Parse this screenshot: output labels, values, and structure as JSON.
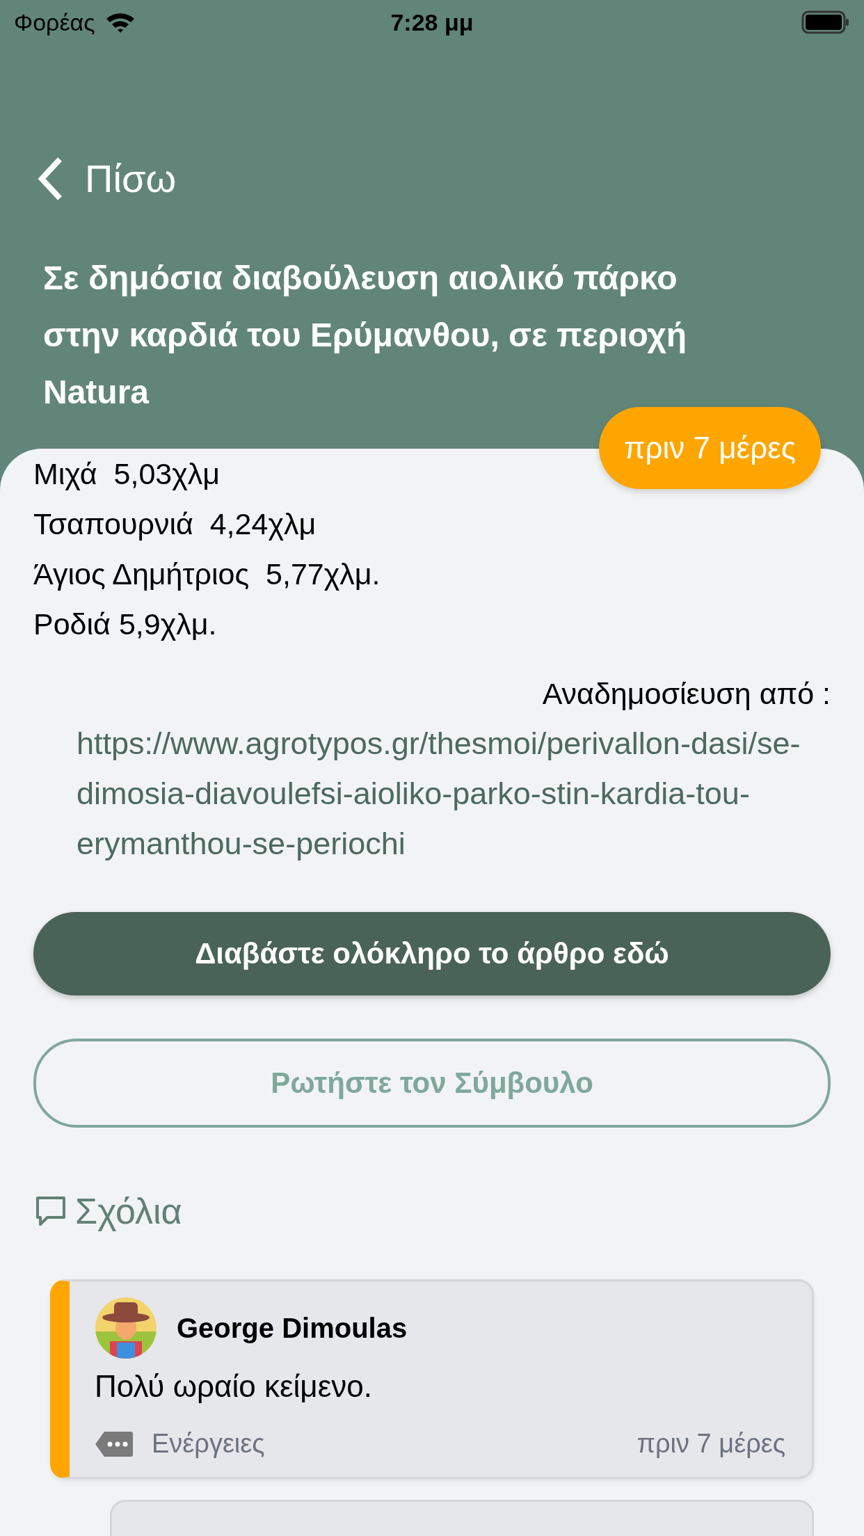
{
  "status_bar": {
    "carrier": "Φορέας",
    "time": "7:28 μμ"
  },
  "nav": {
    "back_label": "Πίσω"
  },
  "article": {
    "title": "Σε δημόσια διαβούλευση αιολικό πάρκο στην καρδιά του Ερύμανθου, σε περιοχή Natura",
    "time_badge": "πριν 7 μέρες",
    "body_lines": [
      "Μιχά  5,03χλμ",
      "Τσαπουρνιά  4,24χλμ",
      "Άγιος Δημήτριος  5,77χλμ.",
      "Ροδιά 5,9χλμ."
    ],
    "repost_label": "Αναδημοσίευση από :",
    "source_url": "https://www.agrotypos.gr/thesmoi/perivallon-dasi/se-dimosia-diavoulefsi-aioliko-parko-stin-kardia-tou-erymanthou-se-periochi"
  },
  "buttons": [
    {
      "kind": "filled",
      "label": "Διαβάστε ολόκληρο το άρθρο εδώ"
    },
    {
      "kind": "outline",
      "label": "Ρωτήστε τον Σύμβουλο"
    }
  ],
  "comments_heading": "Σχόλια",
  "comments": [
    {
      "author": "George Dimoulas",
      "text": "Πολύ ωραίο κείμενο.",
      "action_label": "Ενέργειες",
      "time": "πριν 7 μέρες"
    }
  ]
}
